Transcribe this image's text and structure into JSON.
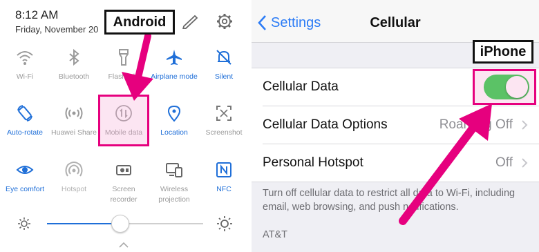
{
  "android": {
    "time": "8:12 AM",
    "date": "Friday, November 20",
    "callout": "Android",
    "tiles": [
      {
        "label": "Wi-Fi",
        "icon": "wifi-icon",
        "state": "off"
      },
      {
        "label": "Bluetooth",
        "icon": "bluetooth-icon",
        "state": "off"
      },
      {
        "label": "Flashlight",
        "icon": "flashlight-icon",
        "state": "off"
      },
      {
        "label": "Airplane mode",
        "icon": "airplane-icon",
        "state": "on"
      },
      {
        "label": "Silent",
        "icon": "silent-bell-icon",
        "state": "on"
      },
      {
        "label": "Auto-rotate",
        "icon": "auto-rotate-icon",
        "state": "on"
      },
      {
        "label": "Huawei Share",
        "icon": "huawei-share-icon",
        "state": "off"
      },
      {
        "label": "Mobile data",
        "icon": "mobile-data-icon",
        "state": "disabled"
      },
      {
        "label": "Location",
        "icon": "location-icon",
        "state": "on"
      },
      {
        "label": "Screenshot",
        "icon": "screenshot-icon",
        "state": "off"
      },
      {
        "label": "Eye comfort",
        "icon": "eye-comfort-icon",
        "state": "on"
      },
      {
        "label": "Hotspot",
        "icon": "hotspot-icon",
        "state": "disabled"
      },
      {
        "label": "Screen recorder",
        "icon": "screen-recorder-icon",
        "state": "off"
      },
      {
        "label": "Wireless projection",
        "icon": "wireless-projection-icon",
        "state": "off"
      },
      {
        "label": "NFC",
        "icon": "nfc-icon",
        "state": "on"
      }
    ],
    "brightness": 0.47
  },
  "ios": {
    "back_label": "Settings",
    "title": "Cellular",
    "callout": "iPhone",
    "rows": [
      {
        "label": "Cellular Data",
        "value": "",
        "toggle": true
      },
      {
        "label": "Cellular Data Options",
        "value": "Roaming Off"
      },
      {
        "label": "Personal Hotspot",
        "value": "Off"
      }
    ],
    "footer": "Turn off cellular data to restrict all data to Wi-Fi, including email, web browsing, and push notifications.",
    "carrier": "AT&T"
  },
  "colors": {
    "accent_blue": "#1f6fd8",
    "ios_blue": "#2c7cf6",
    "toggle_green": "#4cd964",
    "highlight_magenta": "#e6007e"
  }
}
